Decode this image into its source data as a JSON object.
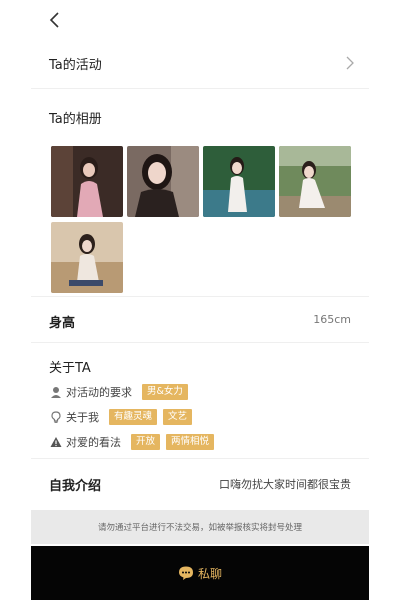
{
  "activity": {
    "title": "Ta的活动"
  },
  "album": {
    "title": "Ta的相册",
    "photos": [
      {
        "alt": "photo-1",
        "tones": [
          "#3a2a24",
          "#d9a7b0"
        ]
      },
      {
        "alt": "photo-2",
        "tones": [
          "#6b5a52",
          "#2b2220"
        ]
      },
      {
        "alt": "photo-3",
        "tones": [
          "#2f5a3a",
          "#e8e4e0"
        ]
      },
      {
        "alt": "photo-4",
        "tones": [
          "#7a8e6a",
          "#f1ece6"
        ]
      },
      {
        "alt": "photo-5",
        "tones": [
          "#c8b49a",
          "#efe6dc"
        ]
      }
    ]
  },
  "height": {
    "label": "身高",
    "value": "165cm"
  },
  "about": {
    "title": "关于TA",
    "items": [
      {
        "icon": "person-icon",
        "label": "对活动的要求",
        "tags": [
          "男&女力"
        ]
      },
      {
        "icon": "lightbulb-icon",
        "label": "关于我",
        "tags": [
          "有趣灵魂",
          "文艺"
        ]
      },
      {
        "icon": "warning-icon",
        "label": "对爱的看法",
        "tags": [
          "开放",
          "两情相悦"
        ]
      }
    ]
  },
  "intro": {
    "label": "自我介绍",
    "value": "口嗨勿扰大家时间都很宝贵"
  },
  "notice": {
    "text": "请勿通过平台进行不法交易，如被举报核实将封号处理"
  },
  "chat": {
    "label": "私聊"
  },
  "colors": {
    "accent": "#e5b660",
    "chat_bar": "#050505",
    "notice_bg": "#e9e9e9"
  }
}
